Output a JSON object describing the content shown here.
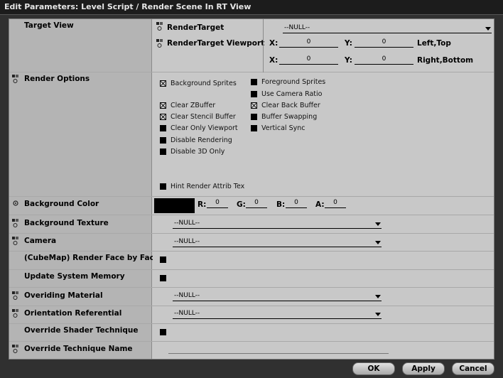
{
  "window": {
    "title": "Edit Parameters: Level Script / Render Scene In RT View"
  },
  "rows": {
    "target_view": {
      "label": "Target View",
      "render_target_label": "RenderTarget",
      "viewport_label": "RenderTarget Viewport",
      "render_target_value": "--NULL--",
      "x1_label": "X:",
      "x1_value": "0",
      "y1_label": "Y:",
      "y1_value": "0",
      "corner1_label": "Left,Top",
      "x2_label": "X:",
      "x2_value": "0",
      "y2_label": "Y:",
      "y2_value": "0",
      "corner2_label": "Right,Bottom"
    },
    "render_options": {
      "label": "Render Options",
      "options": [
        {
          "label": "Background Sprites",
          "checked": true
        },
        {
          "label": "Foreground Sprites",
          "checked": false
        },
        {
          "label": "Use Camera Ratio",
          "checked": false
        },
        {
          "label": "Clear ZBuffer",
          "checked": true
        },
        {
          "label": "Clear Back Buffer",
          "checked": true
        },
        {
          "label": "Clear Stencil Buffer",
          "checked": true
        },
        {
          "label": "Buffer Swapping",
          "checked": false
        },
        {
          "label": "Clear Only Viewport",
          "checked": false
        },
        {
          "label": "Vertical Sync",
          "checked": false
        },
        {
          "label": "Disable Rendering",
          "checked": false
        },
        {
          "label": "Disable 3D Only",
          "checked": false
        },
        {
          "label": "Hint Render Attrib Tex",
          "checked": false
        }
      ]
    },
    "background_color": {
      "label": "Background Color",
      "swatch_color": "#000000",
      "r_label": "R:",
      "r_value": "0",
      "g_label": "G:",
      "g_value": "0",
      "b_label": "B:",
      "b_value": "0",
      "a_label": "A:",
      "a_value": "0"
    },
    "background_texture": {
      "label": "Background Texture",
      "value": "--NULL--"
    },
    "camera": {
      "label": "Camera",
      "value": "--NULL--"
    },
    "cubemap": {
      "label": "(CubeMap) Render Face by Face",
      "checked": false
    },
    "update_memory": {
      "label": "Update System Memory",
      "checked": false
    },
    "overriding_material": {
      "label": "Overiding Material",
      "value": "--NULL--"
    },
    "orientation_referential": {
      "label": "Orientation Referential",
      "value": "--NULL--"
    },
    "override_shader": {
      "label": "Override Shader Technique",
      "checked": false
    },
    "override_technique_name": {
      "label": "Override Technique Name",
      "value": ""
    }
  },
  "buttons": {
    "ok": "OK",
    "apply": "Apply",
    "cancel": "Cancel"
  },
  "icons": {
    "param": "parameter-link-icon",
    "color": "color-link-icon"
  }
}
